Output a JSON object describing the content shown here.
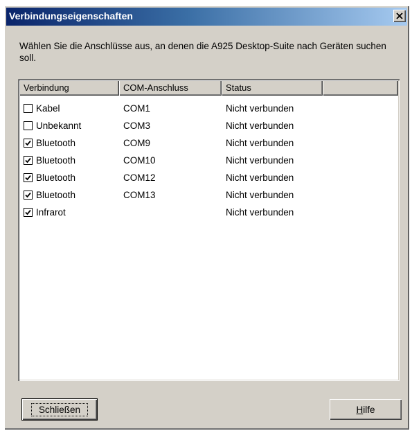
{
  "window": {
    "title": "Verbindungseigenschaften",
    "close_icon": "close-icon"
  },
  "instruction": "Wählen Sie die Anschlüsse aus, an denen die A925 Desktop-Suite nach Geräten suchen soll.",
  "list": {
    "columns": [
      "Verbindung",
      "COM-Anschluss",
      "Status",
      ""
    ],
    "rows": [
      {
        "checked": false,
        "connection": "Kabel",
        "port": "COM1",
        "status": "Nicht verbunden"
      },
      {
        "checked": false,
        "connection": "Unbekannt",
        "port": "COM3",
        "status": "Nicht verbunden"
      },
      {
        "checked": true,
        "connection": "Bluetooth",
        "port": "COM9",
        "status": "Nicht verbunden"
      },
      {
        "checked": true,
        "connection": "Bluetooth",
        "port": "COM10",
        "status": "Nicht verbunden"
      },
      {
        "checked": true,
        "connection": "Bluetooth",
        "port": "COM12",
        "status": "Nicht verbunden"
      },
      {
        "checked": true,
        "connection": "Bluetooth",
        "port": "COM13",
        "status": "Nicht verbunden"
      },
      {
        "checked": true,
        "connection": "Infrarot",
        "port": "",
        "status": "Nicht verbunden"
      }
    ]
  },
  "buttons": {
    "close_label": "Schließen",
    "help_accel": "H",
    "help_rest": "ilfe"
  },
  "colors": {
    "title_gradient_start": "#0a246a",
    "title_gradient_end": "#a6caf0",
    "face": "#d4d0c8"
  }
}
